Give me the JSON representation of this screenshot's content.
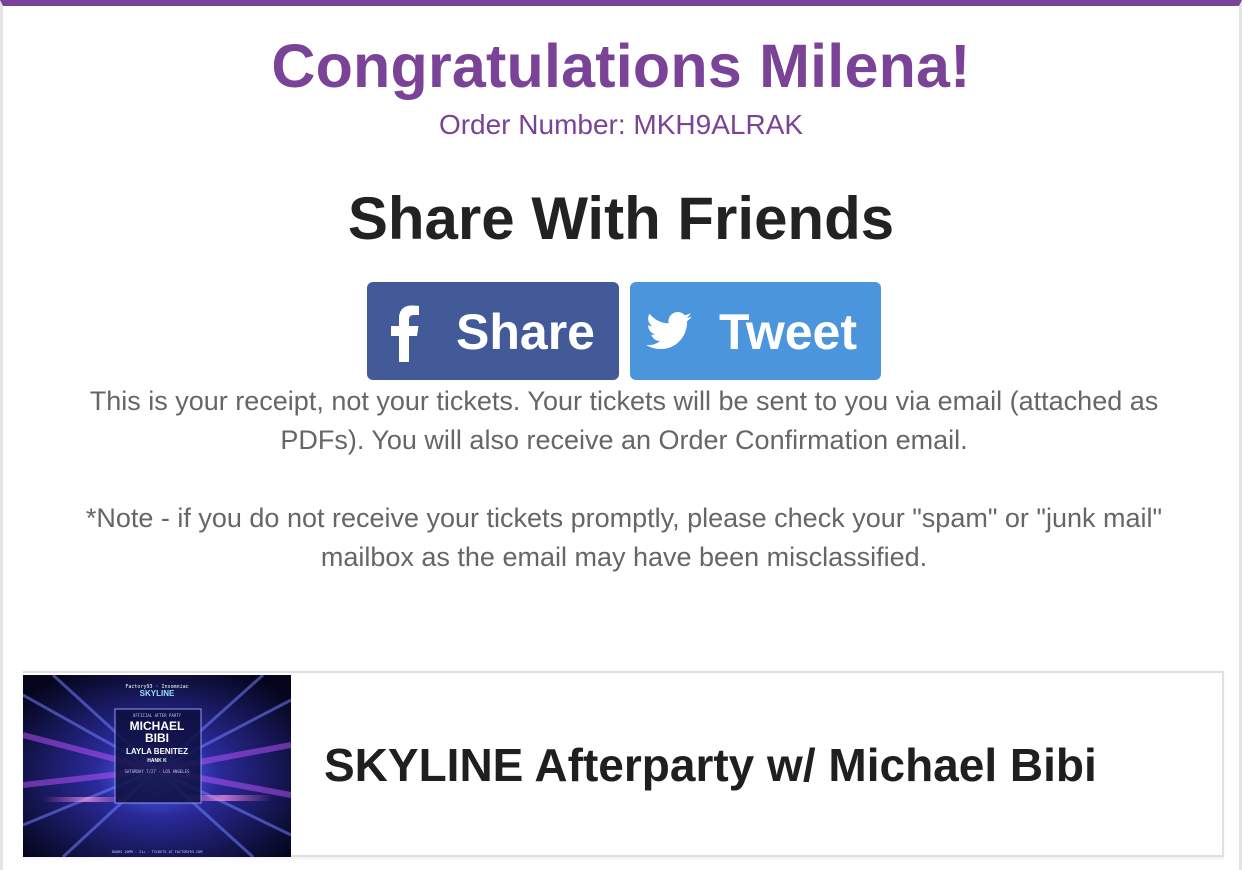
{
  "header": {
    "congrats": "Congratulations Milena!",
    "order_number": "Order Number: MKH9ALRAK"
  },
  "share": {
    "title": "Share With Friends",
    "facebook_label": "Share",
    "twitter_label": "Tweet"
  },
  "messages": {
    "receipt_note": "This is your receipt, not your tickets. Your tickets will be sent to you via email (attached as PDFs). You will also receive an Order Confirmation email.",
    "spam_note": "*Note - if you do not receive your tickets promptly, please check your \"spam\" or \"junk mail\" mailbox as the email may have been misclassified."
  },
  "event": {
    "title": "SKYLINE Afterparty w/ Michael Bibi",
    "flyer": {
      "brand": "Factory93 · Insomniac",
      "series": "SKYLINE",
      "tagline": "OFFICIAL AFTER PARTY",
      "headliner_line1": "MICHAEL",
      "headliner_line2": "BIBI",
      "support": "LAYLA BENITEZ",
      "support2": "HANK K",
      "date_line": "SATURDAY 7/27 · LOS ANGELES",
      "footer": "DOORS 10PM · 21+ · TICKETS AT FACTORY93.COM"
    }
  },
  "colors": {
    "brand_purple": "#7a4397",
    "facebook_blue": "#425a98",
    "twitter_blue": "#4b95dc",
    "heading_dark": "#222222",
    "body_gray": "#666666"
  },
  "icons": {
    "facebook": "facebook-f-icon",
    "twitter": "twitter-bird-icon"
  }
}
